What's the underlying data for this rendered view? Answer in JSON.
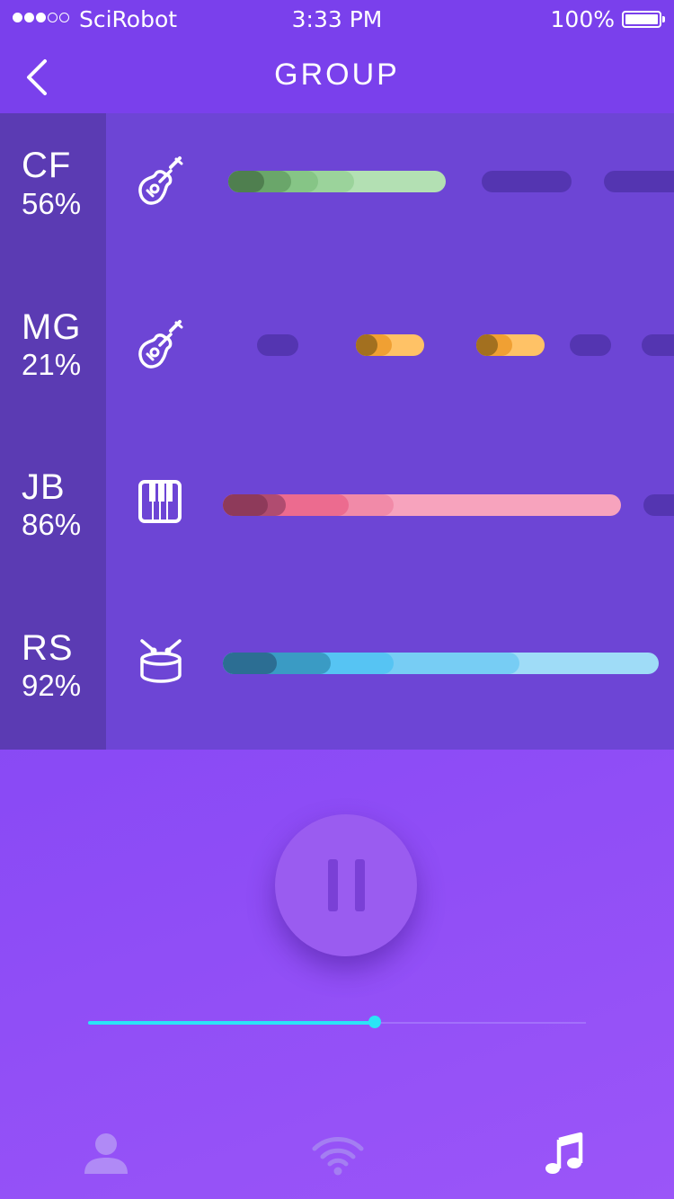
{
  "status_bar": {
    "carrier": "SciRobot",
    "time": "3:33 PM",
    "battery": "100%",
    "signal_bars_filled": 3
  },
  "nav": {
    "title": "GROUP",
    "back_icon": "chevron-left-icon"
  },
  "tracks": [
    {
      "code": "CF",
      "percent": "56%",
      "instrument": "guitar-icon",
      "color": "#8ccf8c"
    },
    {
      "code": "MG",
      "percent": "21%",
      "instrument": "guitar-icon",
      "color": "#ffb84d"
    },
    {
      "code": "JB",
      "percent": "86%",
      "instrument": "piano-icon",
      "color": "#f27ea0"
    },
    {
      "code": "RS",
      "percent": "92%",
      "instrument": "drum-icon",
      "color": "#56c4f3"
    }
  ],
  "player": {
    "state_icon": "pause-icon",
    "progress": 0.575,
    "accent": "#2ae4f6"
  },
  "tabs": [
    {
      "icon": "user-icon",
      "active": false
    },
    {
      "icon": "wifi-icon",
      "active": false
    },
    {
      "icon": "music-note-icon",
      "active": true
    }
  ]
}
